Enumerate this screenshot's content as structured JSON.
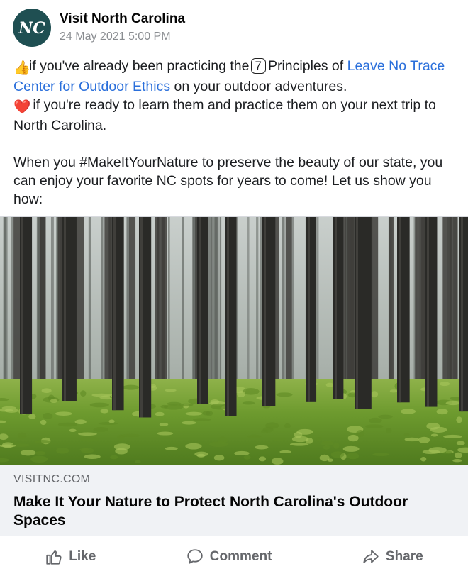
{
  "post": {
    "page_name": "Visit North Carolina",
    "avatar_text": "NC",
    "timestamp": "24 May 2021 5:00 PM",
    "para1": {
      "emoji1": "👍",
      "text1": "if you've already been practicing the",
      "badge": "7",
      "text2": "Principles of",
      "link": "Leave No Trace Center for Outdoor Ethics",
      "text3": "on your outdoor adventures.",
      "emoji2": "❤️",
      "text4": "if you're ready to learn them and practice them on your next trip to North Carolina."
    },
    "para2": "When you #MakeItYourNature to preserve the beauty of our state, you can enjoy your favorite NC spots for years to come! Let us show you how:"
  },
  "link_card": {
    "domain": "VISITNC.COM",
    "title": "Make It Your Nature to Protect North Carolina's Outdoor Spaces"
  },
  "actions": {
    "like": "Like",
    "comment": "Comment",
    "share": "Share"
  },
  "icons": {
    "like": "thumbs-up-icon",
    "comment": "speech-bubble-icon",
    "share": "share-arrow-icon"
  },
  "colors": {
    "avatar_bg": "#1f4f52",
    "link": "#2a6fdb",
    "action_text": "#65676b",
    "card_bg": "#f0f2f5"
  }
}
